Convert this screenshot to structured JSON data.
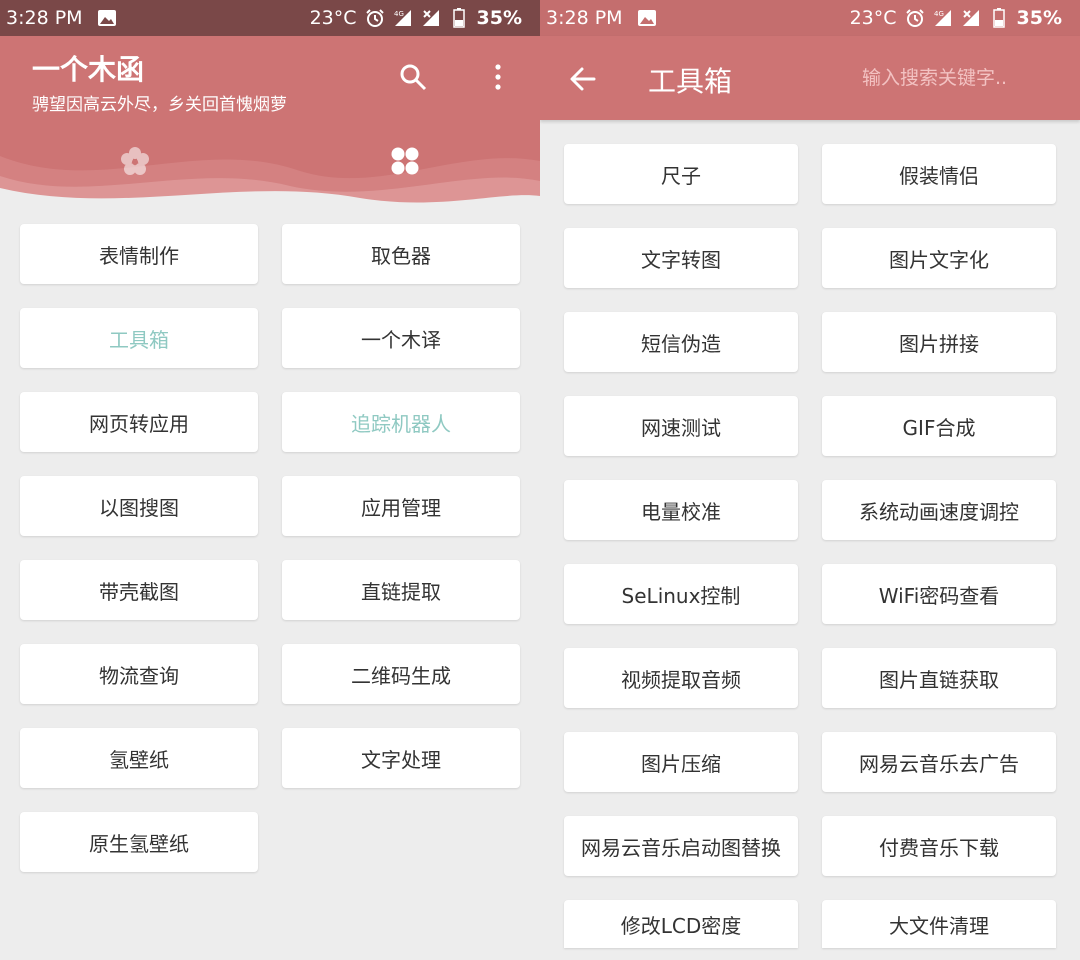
{
  "left": {
    "status": {
      "time": "3:28 PM",
      "temp": "23°C",
      "battery": "35%",
      "network": "4G"
    },
    "app_title": "一个木函",
    "app_subtitle": "骋望因高云外尽，乡关回首愧烟萝",
    "header_icons": [
      "search-icon",
      "more-vert-icon"
    ],
    "tab_icons": [
      "flower-icon",
      "grid-icon"
    ],
    "colors": {
      "accent": "#cd7474",
      "status_bar": "#7a4848",
      "highlight_text": "#8fc9c2"
    },
    "tools": [
      {
        "label": "表情制作",
        "highlight": false
      },
      {
        "label": "取色器",
        "highlight": false
      },
      {
        "label": "工具箱",
        "highlight": true
      },
      {
        "label": "一个木译",
        "highlight": false
      },
      {
        "label": "网页转应用",
        "highlight": false
      },
      {
        "label": "追踪机器人",
        "highlight": true
      },
      {
        "label": "以图搜图",
        "highlight": false
      },
      {
        "label": "应用管理",
        "highlight": false
      },
      {
        "label": "带壳截图",
        "highlight": false
      },
      {
        "label": "直链提取",
        "highlight": false
      },
      {
        "label": "物流查询",
        "highlight": false
      },
      {
        "label": "二维码生成",
        "highlight": false
      },
      {
        "label": "氢壁纸",
        "highlight": false
      },
      {
        "label": "文字处理",
        "highlight": false
      },
      {
        "label": "原生氢壁纸",
        "highlight": false
      }
    ]
  },
  "right": {
    "status": {
      "time": "3:28 PM",
      "temp": "23°C",
      "battery": "35%",
      "network": "4G"
    },
    "title": "工具箱",
    "search": {
      "placeholder": "输入搜索关键字..",
      "value": ""
    },
    "tools": [
      "尺子",
      "假装情侣",
      "文字转图",
      "图片文字化",
      "短信伪造",
      "图片拼接",
      "网速测试",
      "GIF合成",
      "电量校准",
      "系统动画速度调控",
      "SeLinux控制",
      "WiFi密码查看",
      "视频提取音频",
      "图片直链获取",
      "图片压缩",
      "网易云音乐去广告",
      "网易云音乐启动图替换",
      "付费音乐下载",
      "修改LCD密度",
      "大文件清理"
    ]
  }
}
